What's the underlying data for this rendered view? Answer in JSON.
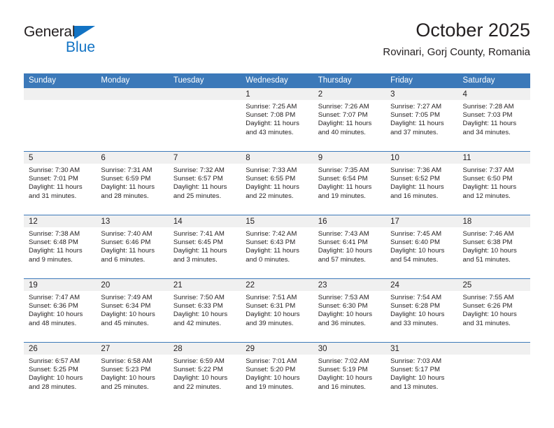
{
  "brand": {
    "name_top": "General",
    "name_bottom": "Blue",
    "triangle_color": "#1273c4",
    "icon": "triangle-logo-icon"
  },
  "header": {
    "title": "October 2025",
    "subtitle": "Rovinari, Gorj County, Romania"
  },
  "theme": {
    "header_blue": "#3c79b9",
    "daynum_band": "#f0f0f0",
    "text": "#231f20"
  },
  "calendar": {
    "weekday_headers": [
      "Sunday",
      "Monday",
      "Tuesday",
      "Wednesday",
      "Thursday",
      "Friday",
      "Saturday"
    ],
    "weeks": [
      [
        {
          "day": "",
          "lines": []
        },
        {
          "day": "",
          "lines": []
        },
        {
          "day": "",
          "lines": []
        },
        {
          "day": "1",
          "lines": [
            "Sunrise: 7:25 AM",
            "Sunset: 7:08 PM",
            "Daylight: 11 hours",
            "and 43 minutes."
          ]
        },
        {
          "day": "2",
          "lines": [
            "Sunrise: 7:26 AM",
            "Sunset: 7:07 PM",
            "Daylight: 11 hours",
            "and 40 minutes."
          ]
        },
        {
          "day": "3",
          "lines": [
            "Sunrise: 7:27 AM",
            "Sunset: 7:05 PM",
            "Daylight: 11 hours",
            "and 37 minutes."
          ]
        },
        {
          "day": "4",
          "lines": [
            "Sunrise: 7:28 AM",
            "Sunset: 7:03 PM",
            "Daylight: 11 hours",
            "and 34 minutes."
          ]
        }
      ],
      [
        {
          "day": "5",
          "lines": [
            "Sunrise: 7:30 AM",
            "Sunset: 7:01 PM",
            "Daylight: 11 hours",
            "and 31 minutes."
          ]
        },
        {
          "day": "6",
          "lines": [
            "Sunrise: 7:31 AM",
            "Sunset: 6:59 PM",
            "Daylight: 11 hours",
            "and 28 minutes."
          ]
        },
        {
          "day": "7",
          "lines": [
            "Sunrise: 7:32 AM",
            "Sunset: 6:57 PM",
            "Daylight: 11 hours",
            "and 25 minutes."
          ]
        },
        {
          "day": "8",
          "lines": [
            "Sunrise: 7:33 AM",
            "Sunset: 6:55 PM",
            "Daylight: 11 hours",
            "and 22 minutes."
          ]
        },
        {
          "day": "9",
          "lines": [
            "Sunrise: 7:35 AM",
            "Sunset: 6:54 PM",
            "Daylight: 11 hours",
            "and 19 minutes."
          ]
        },
        {
          "day": "10",
          "lines": [
            "Sunrise: 7:36 AM",
            "Sunset: 6:52 PM",
            "Daylight: 11 hours",
            "and 16 minutes."
          ]
        },
        {
          "day": "11",
          "lines": [
            "Sunrise: 7:37 AM",
            "Sunset: 6:50 PM",
            "Daylight: 11 hours",
            "and 12 minutes."
          ]
        }
      ],
      [
        {
          "day": "12",
          "lines": [
            "Sunrise: 7:38 AM",
            "Sunset: 6:48 PM",
            "Daylight: 11 hours",
            "and 9 minutes."
          ]
        },
        {
          "day": "13",
          "lines": [
            "Sunrise: 7:40 AM",
            "Sunset: 6:46 PM",
            "Daylight: 11 hours",
            "and 6 minutes."
          ]
        },
        {
          "day": "14",
          "lines": [
            "Sunrise: 7:41 AM",
            "Sunset: 6:45 PM",
            "Daylight: 11 hours",
            "and 3 minutes."
          ]
        },
        {
          "day": "15",
          "lines": [
            "Sunrise: 7:42 AM",
            "Sunset: 6:43 PM",
            "Daylight: 11 hours",
            "and 0 minutes."
          ]
        },
        {
          "day": "16",
          "lines": [
            "Sunrise: 7:43 AM",
            "Sunset: 6:41 PM",
            "Daylight: 10 hours",
            "and 57 minutes."
          ]
        },
        {
          "day": "17",
          "lines": [
            "Sunrise: 7:45 AM",
            "Sunset: 6:40 PM",
            "Daylight: 10 hours",
            "and 54 minutes."
          ]
        },
        {
          "day": "18",
          "lines": [
            "Sunrise: 7:46 AM",
            "Sunset: 6:38 PM",
            "Daylight: 10 hours",
            "and 51 minutes."
          ]
        }
      ],
      [
        {
          "day": "19",
          "lines": [
            "Sunrise: 7:47 AM",
            "Sunset: 6:36 PM",
            "Daylight: 10 hours",
            "and 48 minutes."
          ]
        },
        {
          "day": "20",
          "lines": [
            "Sunrise: 7:49 AM",
            "Sunset: 6:34 PM",
            "Daylight: 10 hours",
            "and 45 minutes."
          ]
        },
        {
          "day": "21",
          "lines": [
            "Sunrise: 7:50 AM",
            "Sunset: 6:33 PM",
            "Daylight: 10 hours",
            "and 42 minutes."
          ]
        },
        {
          "day": "22",
          "lines": [
            "Sunrise: 7:51 AM",
            "Sunset: 6:31 PM",
            "Daylight: 10 hours",
            "and 39 minutes."
          ]
        },
        {
          "day": "23",
          "lines": [
            "Sunrise: 7:53 AM",
            "Sunset: 6:30 PM",
            "Daylight: 10 hours",
            "and 36 minutes."
          ]
        },
        {
          "day": "24",
          "lines": [
            "Sunrise: 7:54 AM",
            "Sunset: 6:28 PM",
            "Daylight: 10 hours",
            "and 33 minutes."
          ]
        },
        {
          "day": "25",
          "lines": [
            "Sunrise: 7:55 AM",
            "Sunset: 6:26 PM",
            "Daylight: 10 hours",
            "and 31 minutes."
          ]
        }
      ],
      [
        {
          "day": "26",
          "lines": [
            "Sunrise: 6:57 AM",
            "Sunset: 5:25 PM",
            "Daylight: 10 hours",
            "and 28 minutes."
          ]
        },
        {
          "day": "27",
          "lines": [
            "Sunrise: 6:58 AM",
            "Sunset: 5:23 PM",
            "Daylight: 10 hours",
            "and 25 minutes."
          ]
        },
        {
          "day": "28",
          "lines": [
            "Sunrise: 6:59 AM",
            "Sunset: 5:22 PM",
            "Daylight: 10 hours",
            "and 22 minutes."
          ]
        },
        {
          "day": "29",
          "lines": [
            "Sunrise: 7:01 AM",
            "Sunset: 5:20 PM",
            "Daylight: 10 hours",
            "and 19 minutes."
          ]
        },
        {
          "day": "30",
          "lines": [
            "Sunrise: 7:02 AM",
            "Sunset: 5:19 PM",
            "Daylight: 10 hours",
            "and 16 minutes."
          ]
        },
        {
          "day": "31",
          "lines": [
            "Sunrise: 7:03 AM",
            "Sunset: 5:17 PM",
            "Daylight: 10 hours",
            "and 13 minutes."
          ]
        },
        {
          "day": "",
          "lines": []
        }
      ]
    ]
  }
}
